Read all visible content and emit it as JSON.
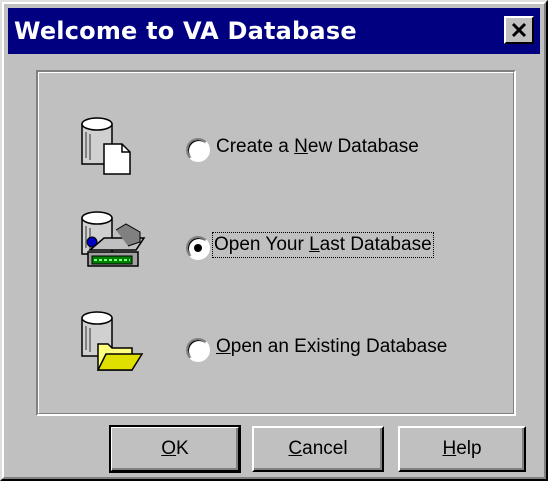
{
  "window": {
    "title": "Welcome to VA Database",
    "title_bar_color": "#000080",
    "background_color": "#c0c0c0"
  },
  "options": [
    {
      "pre": "Create a ",
      "key": "N",
      "post": "ew Database",
      "selected": false,
      "icon": "database-new-document-icon"
    },
    {
      "pre": "Open Your ",
      "key": "L",
      "post": "ast Database",
      "selected": true,
      "icon": "database-computer-icon"
    },
    {
      "pre": "",
      "key": "O",
      "post": "pen an Existing Database",
      "selected": false,
      "icon": "database-folder-icon"
    }
  ],
  "buttons": {
    "ok": {
      "key": "O",
      "rest": "K"
    },
    "cancel": {
      "key": "C",
      "rest": "ancel"
    },
    "help": {
      "key": "H",
      "rest": "elp"
    }
  }
}
